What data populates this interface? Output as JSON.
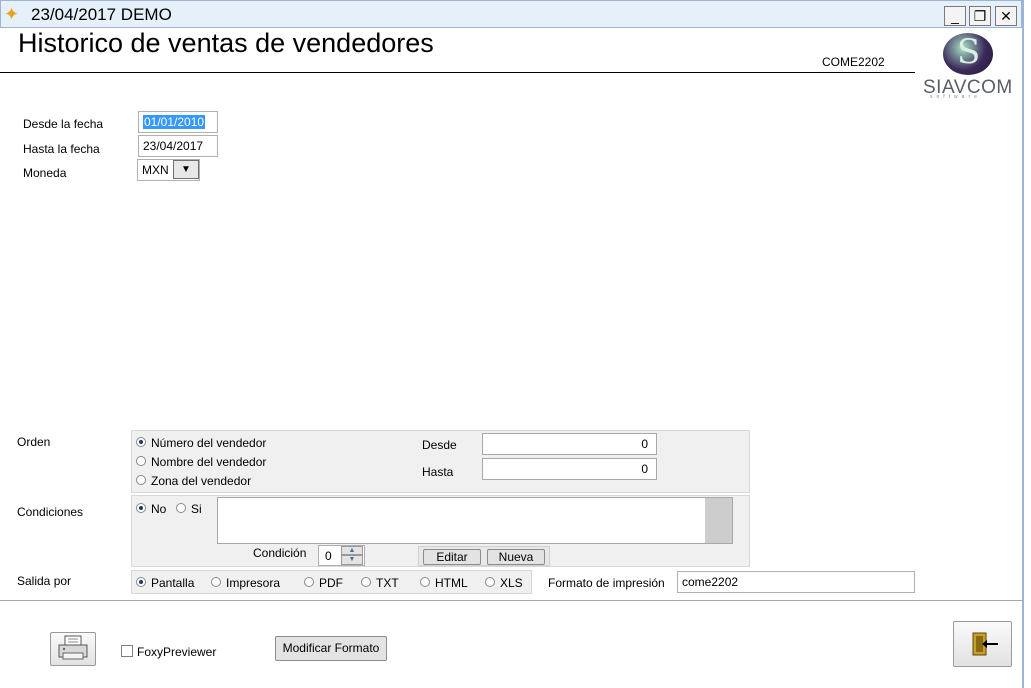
{
  "window": {
    "title": "23/04/2017  DEMO",
    "icon": "app-bird-icon",
    "controls": {
      "minimize": "_",
      "restore": "❐",
      "close": "✕"
    }
  },
  "header": {
    "title": "Historico de ventas de vendedores",
    "form_code": "COME2202",
    "logo_text": "SIAVCOM",
    "logo_sub": "software",
    "logo_letter": "S"
  },
  "fields": {
    "desde_fecha": {
      "label": "Desde la fecha",
      "value": "01/01/2010"
    },
    "hasta_fecha": {
      "label": "Hasta la fecha",
      "value": "23/04/2017"
    },
    "moneda": {
      "label": "Moneda",
      "value": "MXN",
      "dropdown_glyph": "▼"
    }
  },
  "orden": {
    "label": "Orden",
    "options": [
      {
        "label": "Número del vendedor",
        "selected": true
      },
      {
        "label": "Nombre del vendedor",
        "selected": false
      },
      {
        "label": "Zona del vendedor",
        "selected": false
      }
    ],
    "desde_label": "Desde",
    "desde_value": "0",
    "hasta_label": "Hasta",
    "hasta_value": "0"
  },
  "condiciones": {
    "label": "Condiciones",
    "options": [
      {
        "label": "No",
        "selected": true
      },
      {
        "label": "Si",
        "selected": false
      }
    ],
    "text": "",
    "condicion_label": "Condición",
    "condicion_value": "0",
    "editar_label": "Editar",
    "nueva_label": "Nueva"
  },
  "salida": {
    "label": "Salida por",
    "options": [
      {
        "label": "Pantalla",
        "selected": true
      },
      {
        "label": "Impresora",
        "selected": false
      },
      {
        "label": "PDF",
        "selected": false
      },
      {
        "label": "TXT",
        "selected": false
      },
      {
        "label": "HTML",
        "selected": false
      },
      {
        "label": "XLS",
        "selected": false
      }
    ],
    "formato_label": "Formato de impresión",
    "formato_value": "come2202"
  },
  "footer": {
    "print_icon": "printer-icon",
    "foxy_label": "FoxyPreviewer",
    "foxy_checked": false,
    "modificar_label": "Modificar Formato",
    "exit_icon": "exit-door-icon"
  }
}
